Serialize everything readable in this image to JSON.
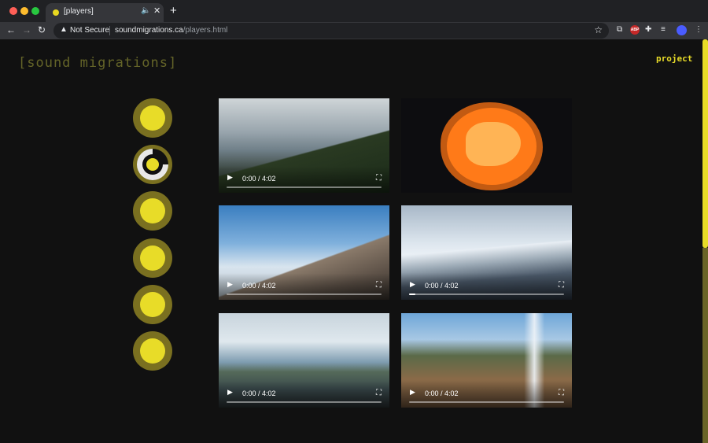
{
  "browser": {
    "tab_title": "[players]",
    "tab_audio_icon": "speaker-icon",
    "tab_close": "✕",
    "new_tab": "+",
    "security": "Not Secure",
    "url_host": "soundmigrations.ca",
    "url_path": "/players.html",
    "extensions": [
      "cast-icon",
      "abp-icon",
      "puzzle-icon",
      "playlist-icon",
      "profile-avatar",
      "menu-icon"
    ],
    "abp_label": "ABP"
  },
  "site": {
    "title": "[sound migrations]",
    "nav_link": "project",
    "accent_color": "#e8dc28",
    "dim_accent_color": "#646428"
  },
  "players": [
    {
      "state": "idle"
    },
    {
      "state": "active"
    },
    {
      "state": "idle"
    },
    {
      "state": "idle"
    },
    {
      "state": "idle"
    },
    {
      "state": "idle"
    }
  ],
  "videos": [
    {
      "scene": "forest",
      "time": "0:00 / 4:02",
      "progress": 0.0,
      "controls": true
    },
    {
      "scene": "sun",
      "time": "",
      "progress": 0.0,
      "controls": false
    },
    {
      "scene": "mountain",
      "time": "0:00 / 4:02",
      "progress": 0.0,
      "controls": true
    },
    {
      "scene": "snowy-peaks",
      "time": "0:00 / 4:02",
      "progress": 0.04,
      "controls": true
    },
    {
      "scene": "lake",
      "time": "0:00 / 4:02",
      "progress": 0.0,
      "controls": true
    },
    {
      "scene": "waterfall",
      "time": "0:00 / 4:02",
      "progress": 0.0,
      "controls": true
    }
  ]
}
